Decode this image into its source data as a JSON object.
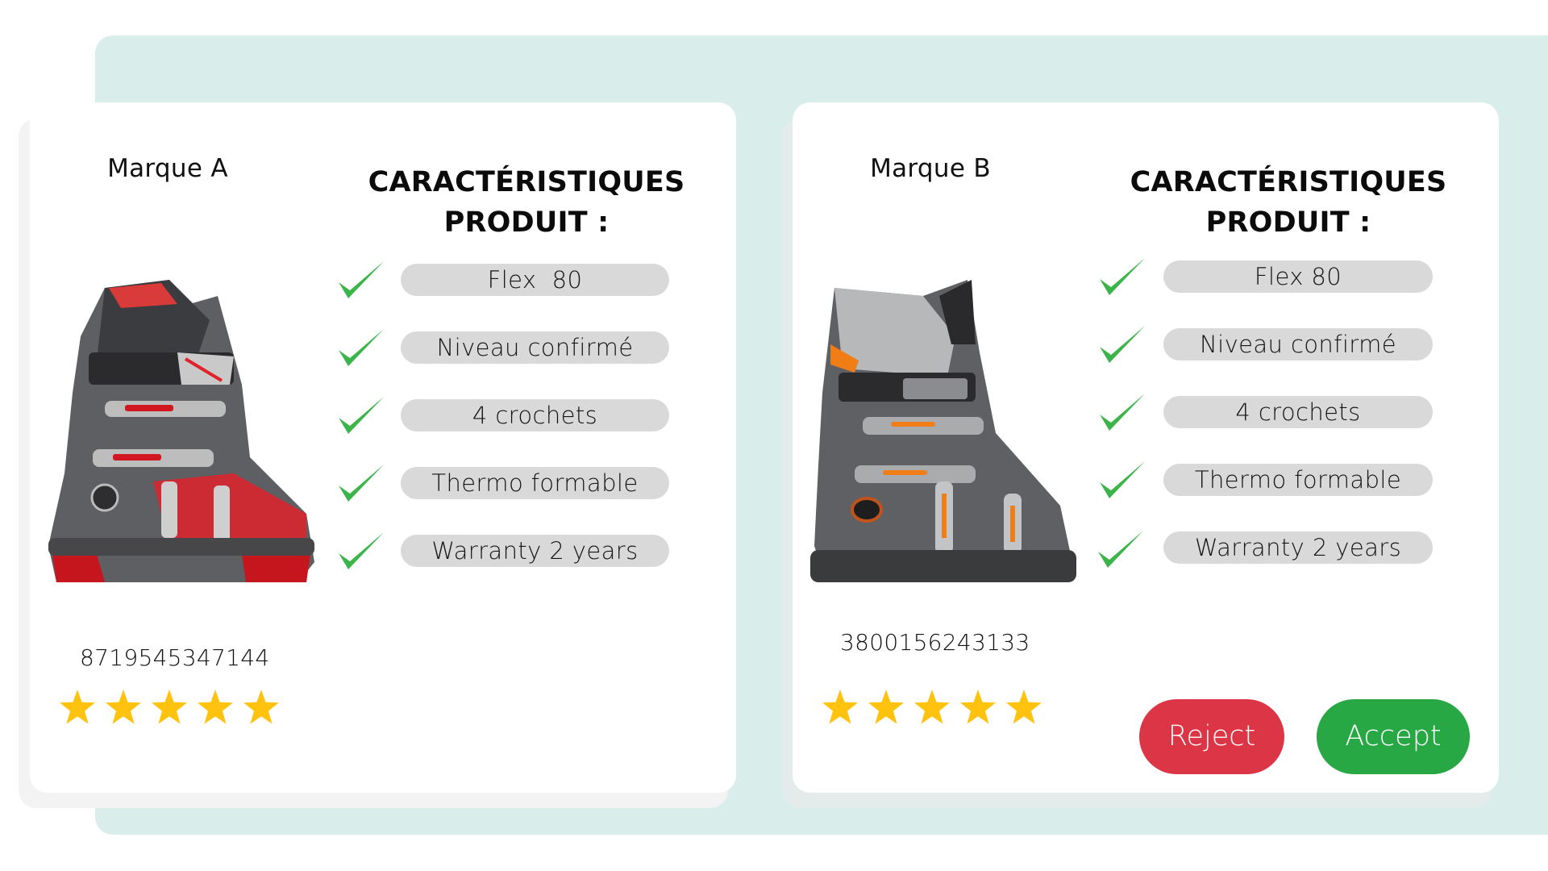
{
  "colors": {
    "background_accent": "#d9eeeb",
    "pill_bg": "#d9d9d9",
    "check_green": "#3bb54a",
    "star_gold": "#ffc20e",
    "reject_red": "#dc3545",
    "accept_green": "#28a745"
  },
  "products": [
    {
      "brand": "Marque A",
      "heading_line1": "CARACTÉRISTIQUES",
      "heading_line2": "PRODUIT :",
      "features": [
        "Flex  80",
        "Niveau confirmé",
        "4 crochets",
        "Thermo formable",
        "Warranty 2 years"
      ],
      "ean": "8719545347144",
      "rating": 5,
      "rating_max": 5,
      "image": "ski-boot-red-grey",
      "accent_color": "#e0222a"
    },
    {
      "brand": "Marque B",
      "heading_line1": "CARACTÉRISTIQUES",
      "heading_line2": "PRODUIT :",
      "features": [
        "Flex 80",
        "Niveau confirmé",
        "4 crochets",
        "Thermo formable",
        "Warranty 2 years"
      ],
      "ean": "3800156243133",
      "rating": 5,
      "rating_max": 5,
      "image": "ski-boot-grey-orange",
      "accent_color": "#f07d16"
    }
  ],
  "actions": {
    "reject_label": "Reject",
    "accept_label": "Accept"
  }
}
